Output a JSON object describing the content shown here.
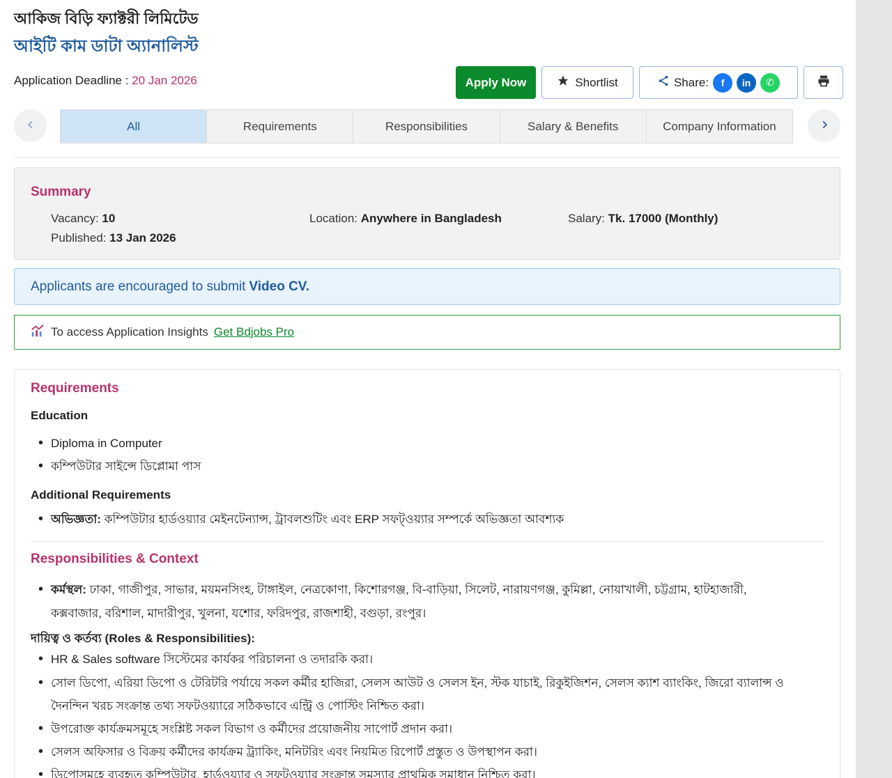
{
  "header": {
    "company": "আকিজ বিড়ি ফ্যাক্টরী লিমিটেড",
    "job_title": "আইটি কাম ডাটা অ্যানালিস্ট",
    "deadline_label": "Application Deadline :",
    "deadline_date": "20 Jan 2026"
  },
  "actions": {
    "apply": "Apply Now",
    "shortlist": "Shortlist",
    "share": "Share:",
    "facebook": "f",
    "linkedin": "in",
    "whatsapp": "✆"
  },
  "tabs": [
    "All",
    "Requirements",
    "Responsibilities",
    "Salary & Benefits",
    "Company Information"
  ],
  "summary": {
    "title": "Summary",
    "vacancy_label": "Vacancy:",
    "vacancy_value": "10",
    "location_label": "Location:",
    "location_value": "Anywhere in Bangladesh",
    "salary_label": "Salary:",
    "salary_value": "Tk. 17000 (Monthly)",
    "published_label": "Published:",
    "published_value": "13 Jan 2026"
  },
  "notice": {
    "text": "Applicants are encouraged to submit",
    "emphasis": "Video CV."
  },
  "insights": {
    "text": "To access Application Insights",
    "link": "Get Bdjobs Pro"
  },
  "requirements": {
    "title": "Requirements",
    "education_head": "Education",
    "education": [
      "Diploma in Computer",
      "কম্পিউটার সাইন্সে ডিপ্লোমা পাস"
    ],
    "additional_head": "Additional Requirements",
    "additional_label": "অভিজ্ঞতা:",
    "additional_text": "কম্পিউটার হার্ডওয়্যার মেইনটেন্যান্স, ট্রাবলশুটিং এবং ERP সফট্ওয়্যার সম্পর্কে অভিজ্ঞতা আবশ্যক"
  },
  "responsibilities": {
    "title": "Responsibilities & Context",
    "workplace_label": "কর্মস্থল:",
    "workplace_line1": "ঢাকা, গাজীপুর, সাভার, ময়মনসিংহ, টাঙ্গাইল, নেত্রকোণা, কিশোরগঞ্জ, বি-বাড়িয়া, সিলেট, নারায়ণগঞ্জ, কুমিল্লা, নোয়াখালী, চট্টগ্রাম, হাটহাজারী,",
    "workplace_line2": "কক্সবাজার, বরিশাল, মাদারীপুর, খুলনা, যশোর, ফরিদপুর, রাজশাহী, বগুড়া, রংপুর।",
    "roles_head": "দায়িত্ব ও কর্তব্য (Roles & Responsibilities):",
    "items": [
      "HR & Sales software সিস্টেমের কার্যকর পরিচালনা ও তদারকি করা।",
      "সোল ডিপো, এরিয়া ডিপো ও টেরিটরি পর্যায়ে সকল কর্মীর হাজিরা, সেলস আউট ও সেলস ইন, স্টক যাচাই, রিকুইজিশন, সেলস ক্যাশ ব্যাংকিং, জিরো ব্যালান্স ও",
      "দৈনন্দিন খরচ সংক্রান্ত তথ্য সফটওয়্যারে সঠিকভাবে এন্ট্রি ও পোস্টিং নিশ্চিত করা।",
      "উপরোক্ত কার্যক্রমসমূহে সংশ্লিষ্ট সকল বিভাগ ও কর্মীদের প্রয়োজনীয় সাপোর্ট প্রদান করা।",
      "সেলস অফিসার ও বিক্রয় কর্মীদের কার্যক্রম ট্র্যাকিং, মনিটরিং এবং নিয়মিত রিপোর্ট প্রস্তুত ও উপস্থাপন করা।",
      "ডিপোসমূহে ব্যবহৃত কম্পিউটার, হার্ডওয়্যার ও সফটওয়্যার সংক্রান্ত সমস্যার প্রাথমিক সমাধান নিশ্চিত করা।"
    ]
  }
}
